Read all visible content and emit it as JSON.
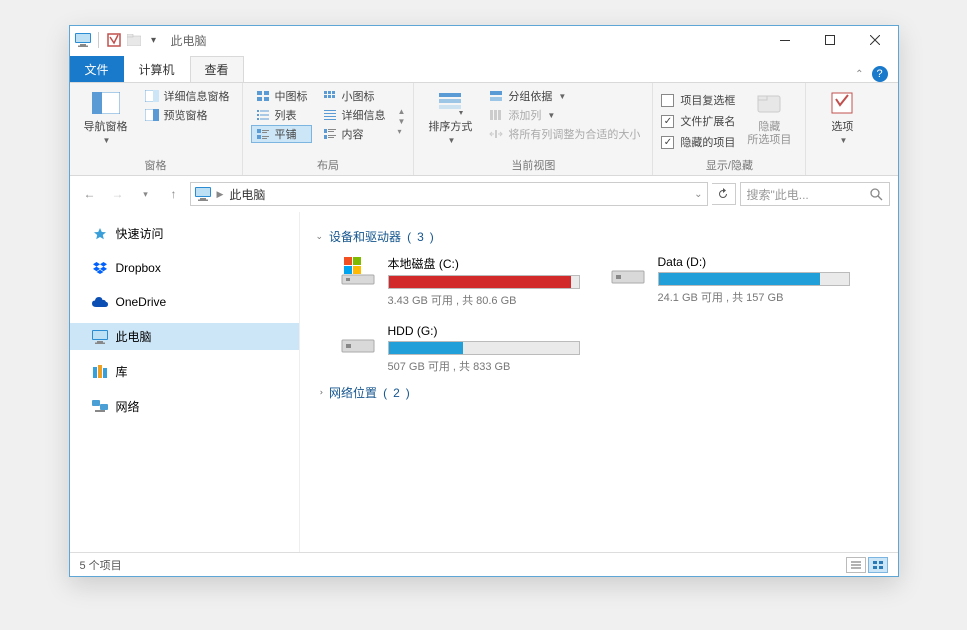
{
  "title": "此电脑",
  "tabs": {
    "file": "文件",
    "computer": "计算机",
    "view": "查看"
  },
  "ribbon": {
    "panes": {
      "label": "窗格",
      "nav": "导航窗格",
      "detail": "详细信息窗格",
      "preview": "预览窗格"
    },
    "layout": {
      "label": "布局",
      "medium": "中图标",
      "small": "小图标",
      "list": "列表",
      "details": "详细信息",
      "tiles": "平铺",
      "content": "内容"
    },
    "current": {
      "label": "当前视图",
      "sort": "排序方式",
      "group": "分组依据",
      "addcol": "添加列",
      "autosize": "将所有列调整为合适的大小"
    },
    "showhide": {
      "label": "显示/隐藏",
      "itemchk": "项目复选框",
      "ext": "文件扩展名",
      "hidden": "隐藏的项目",
      "hide": "隐藏",
      "hidesub": "所选项目"
    },
    "options": {
      "label": "选项"
    }
  },
  "address": {
    "seg": "此电脑"
  },
  "search": {
    "placeholder": "搜索\"此电..."
  },
  "sidebar": {
    "quick": "快速访问",
    "dropbox": "Dropbox",
    "onedrive": "OneDrive",
    "thispc": "此电脑",
    "libraries": "库",
    "network": "网络"
  },
  "sections": {
    "drives": {
      "label": "设备和驱动器",
      "count": 3
    },
    "network": {
      "label": "网络位置",
      "count": 2
    }
  },
  "drives": [
    {
      "name": "本地磁盘 (C:)",
      "stat": "3.43 GB 可用 , 共 80.6 GB",
      "fill": 96,
      "color": "#d22a2a",
      "type": "os"
    },
    {
      "name": "Data (D:)",
      "stat": "24.1 GB 可用 , 共 157 GB",
      "fill": 85,
      "color": "#219fd9",
      "type": "hdd"
    },
    {
      "name": "HDD (G:)",
      "stat": "507 GB 可用 , 共 833 GB",
      "fill": 39,
      "color": "#219fd9",
      "type": "hdd"
    }
  ],
  "status": {
    "text": "5 个项目"
  }
}
